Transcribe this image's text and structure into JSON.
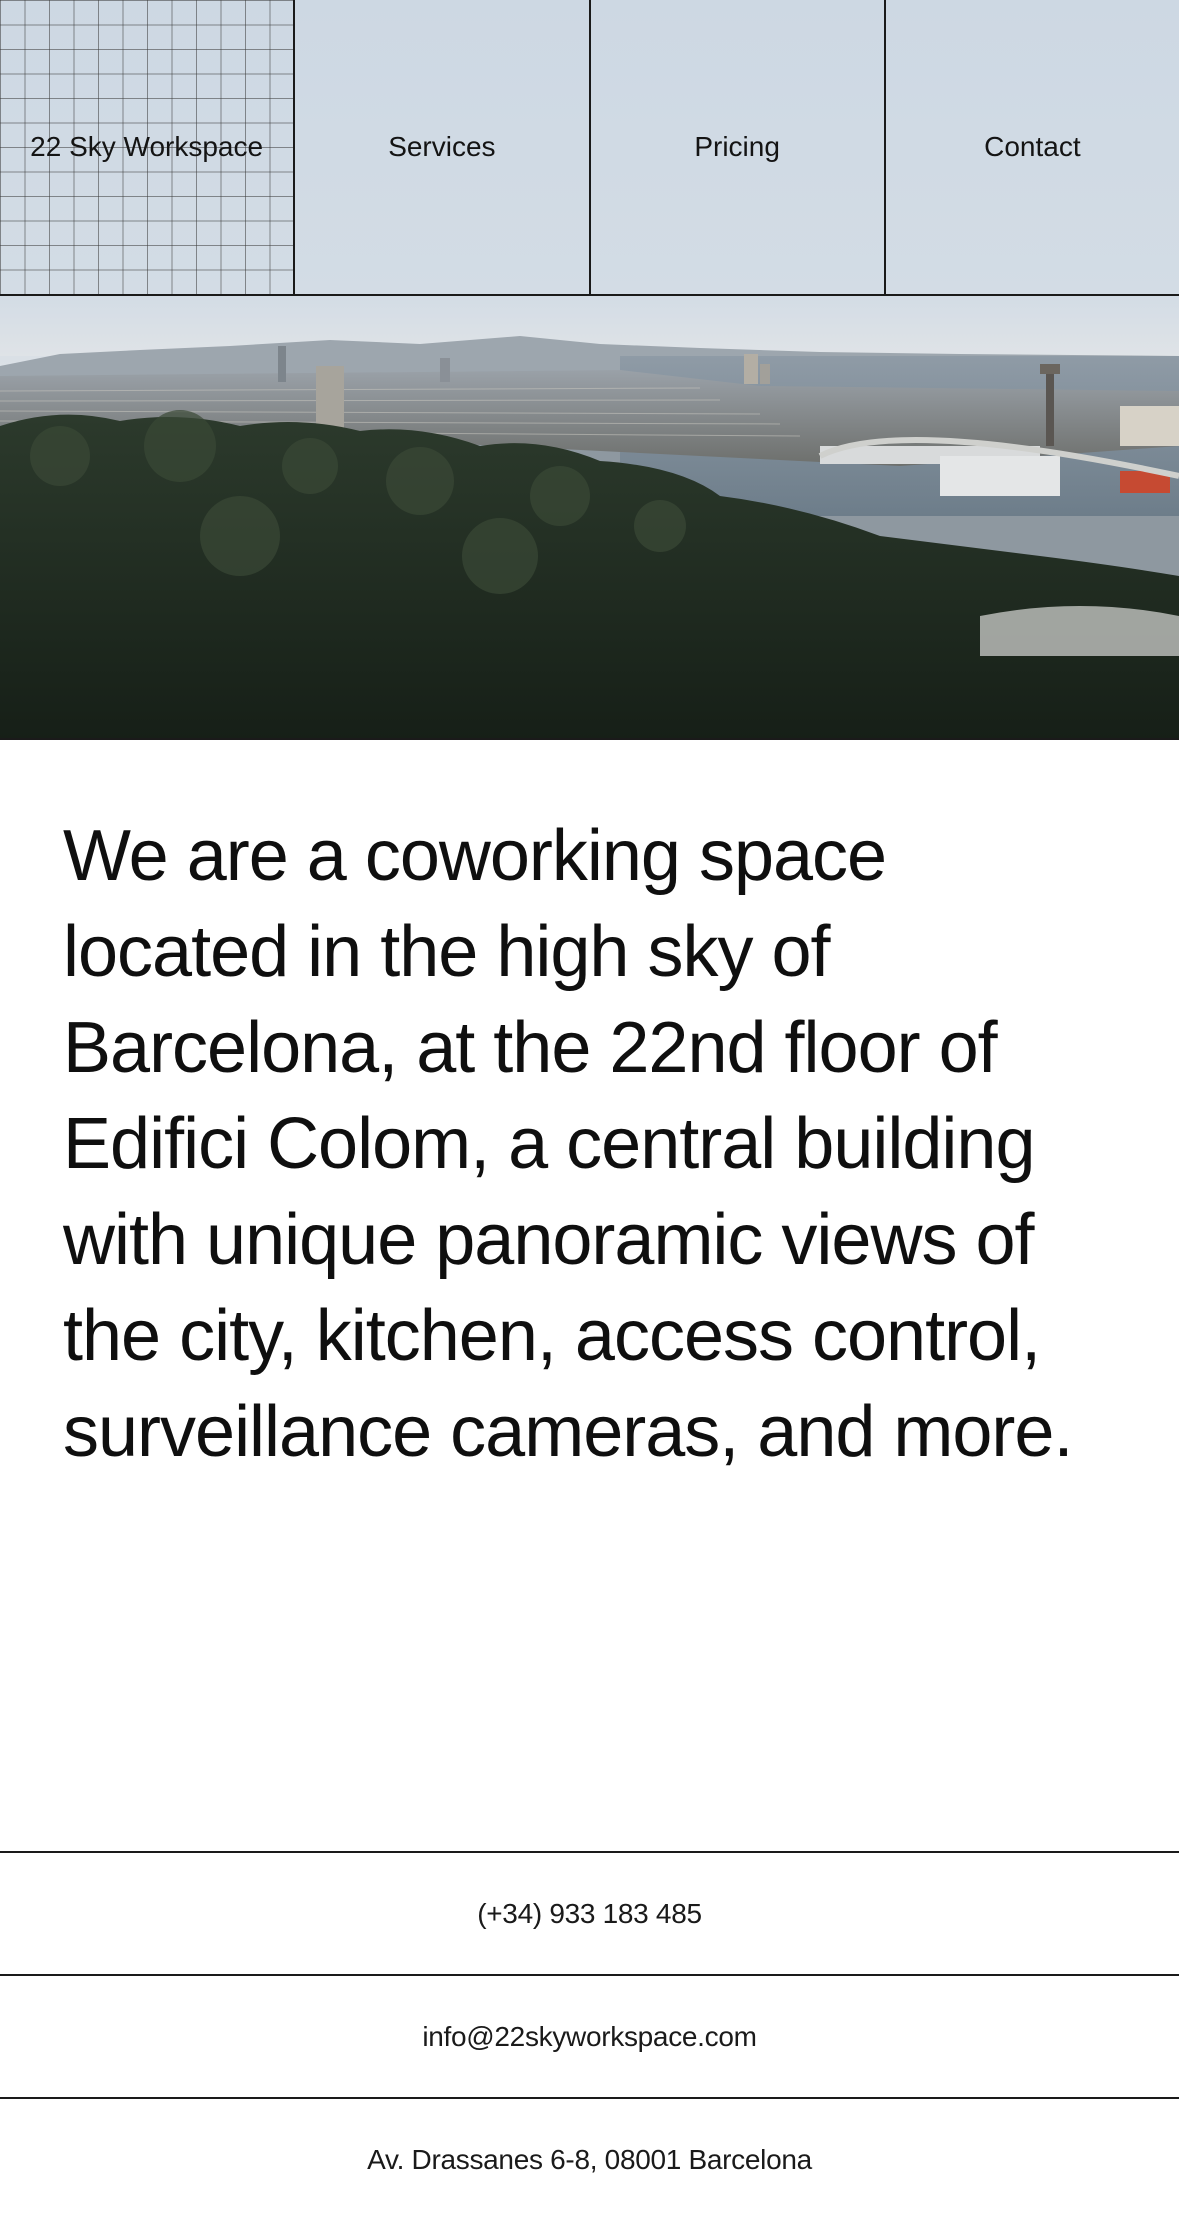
{
  "nav": {
    "brand": "22 Sky Workspace",
    "items": [
      {
        "label": "Services"
      },
      {
        "label": "Pricing"
      },
      {
        "label": "Contact"
      }
    ]
  },
  "hero": {
    "image": "barcelona-panorama-image"
  },
  "about": {
    "text": "We are a coworking space located in the high sky of Barcelona, at the 22nd floor of Edifici Colom, a central building with unique panoramic views of the city, kitchen, access control, surveillance cameras, and more."
  },
  "contact": {
    "phone": "(+34) 933 183 485",
    "email": "info@22skyworkspace.com",
    "address": "Av. Drassanes 6-8, 08001 Barcelona"
  },
  "colors": {
    "text": "#111111",
    "border": "#1a1a1a",
    "sky": "#cdd8e3",
    "background": "#ffffff"
  }
}
